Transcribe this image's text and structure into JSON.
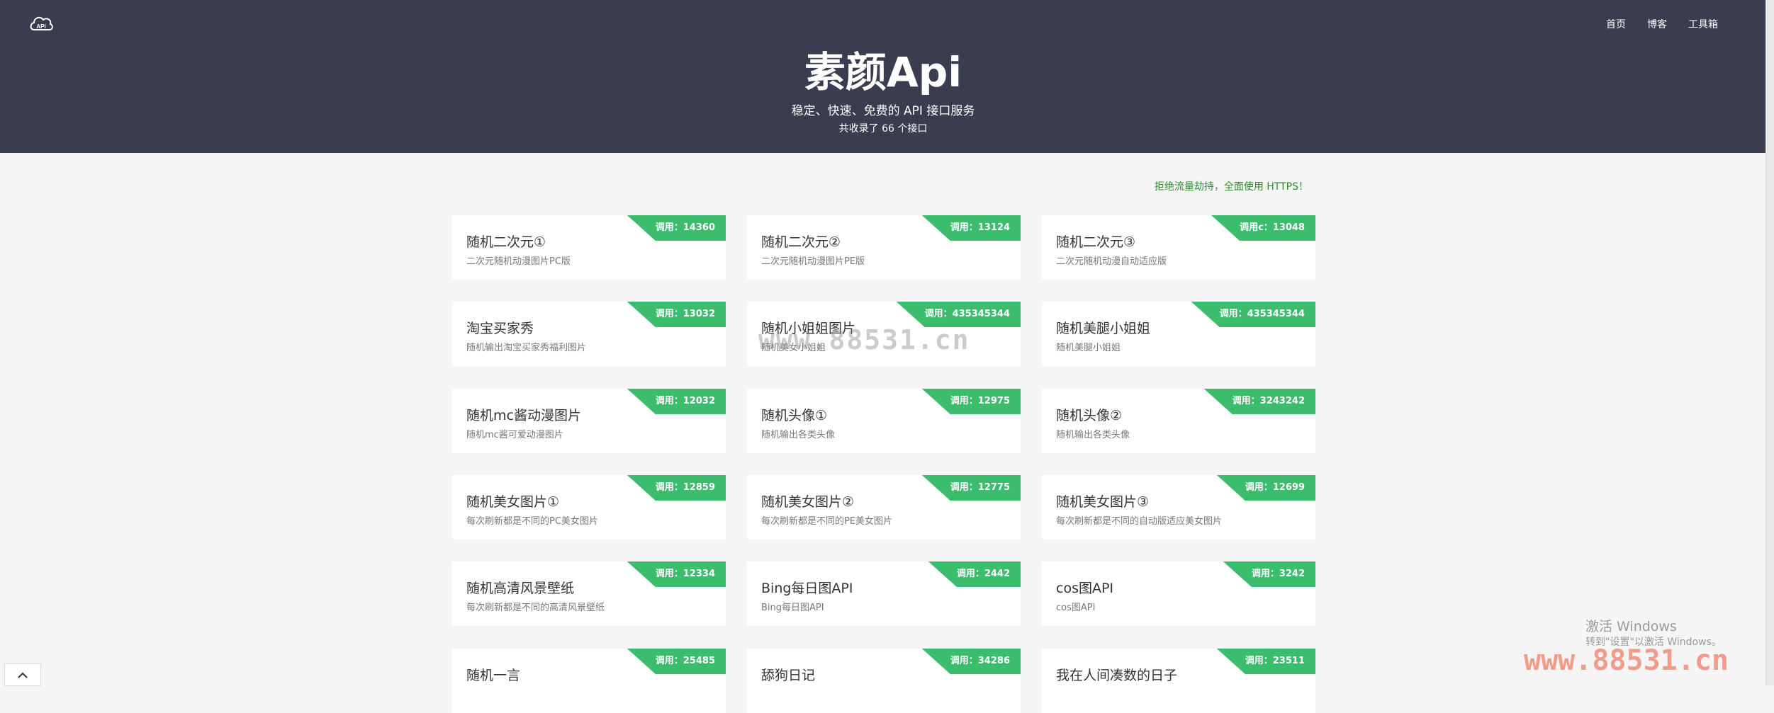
{
  "header": {
    "logo_text": "API",
    "title": "素颜Api",
    "subtitle": "稳定、快速、免费的 API 接口服务",
    "count_text": "共收录了 66 个接口",
    "nav": [
      {
        "label": "首页"
      },
      {
        "label": "博客"
      },
      {
        "label": "工具箱"
      }
    ]
  },
  "notice": "拒绝流量劫持，全面使用 HTTPS！",
  "cards": [
    {
      "title": "随机二次元①",
      "desc": "二次元随机动漫图片PC版",
      "badge": "调用：14360"
    },
    {
      "title": "随机二次元②",
      "desc": "二次元随机动漫图片PE版",
      "badge": "调用：13124"
    },
    {
      "title": "随机二次元③",
      "desc": "二次元随机动漫自动适应版",
      "badge": "调用c：13048"
    },
    {
      "title": "淘宝买家秀",
      "desc": "随机输出淘宝买家秀福利图片",
      "badge": "调用：13032"
    },
    {
      "title": "随机小姐姐图片",
      "desc": "随机美女小姐姐",
      "badge": "调用：435345344"
    },
    {
      "title": "随机美腿小姐姐",
      "desc": "随机美腿小姐姐",
      "badge": "调用：435345344"
    },
    {
      "title": "随机mc酱动漫图片",
      "desc": "随机mc酱可爱动漫图片",
      "badge": "调用：12032"
    },
    {
      "title": "随机头像①",
      "desc": "随机输出各类头像",
      "badge": "调用：12975"
    },
    {
      "title": "随机头像②",
      "desc": "随机输出各类头像",
      "badge": "调用：3243242"
    },
    {
      "title": "随机美女图片①",
      "desc": "每次刷新都是不同的PC美女图片",
      "badge": "调用：12859"
    },
    {
      "title": "随机美女图片②",
      "desc": "每次刷新都是不同的PE美女图片",
      "badge": "调用：12775"
    },
    {
      "title": "随机美女图片③",
      "desc": "每次刷新都是不同的自动版适应美女图片",
      "badge": "调用：12699"
    },
    {
      "title": "随机高清风景壁纸",
      "desc": "每次刷新都是不同的高清风景壁纸",
      "badge": "调用：12334"
    },
    {
      "title": "Bing每日图API",
      "desc": "Bing每日图API",
      "badge": "调用：2442"
    },
    {
      "title": "cos图API",
      "desc": "cos图API",
      "badge": "调用：3242"
    },
    {
      "title": "随机一言",
      "desc": "",
      "badge": "调用：25485"
    },
    {
      "title": "舔狗日记",
      "desc": "",
      "badge": "调用：34286"
    },
    {
      "title": "我在人间凑数的日子",
      "desc": "",
      "badge": "调用：23511"
    }
  ],
  "watermark_center": "www.88531.cn",
  "watermark_corner": "www.88531.cn",
  "windows_activation": {
    "line1": "激活 Windows",
    "line2": "转到\"设置\"以激活 Windows。"
  },
  "back_to_top_icon": "chevron-up-icon"
}
